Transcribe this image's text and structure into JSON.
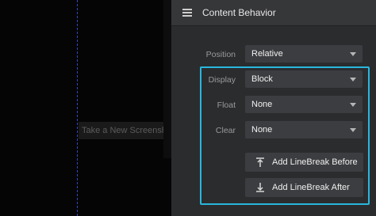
{
  "canvas": {
    "ghost_label": "Take a New Screenshot"
  },
  "panel": {
    "title": "Content Behavior",
    "menu_icon": "hamburger-icon",
    "rows": {
      "position": {
        "label": "Position",
        "value": "Relative"
      },
      "display": {
        "label": "Display",
        "value": "Block"
      },
      "float": {
        "label": "Float",
        "value": "None"
      },
      "clear": {
        "label": "Clear",
        "value": "None"
      }
    },
    "buttons": {
      "linebreak_before": {
        "label": "Add LineBreak Before",
        "icon": "linebreak-before-icon"
      },
      "linebreak_after": {
        "label": "Add LineBreak After",
        "icon": "linebreak-after-icon"
      }
    }
  },
  "colors": {
    "highlight": "#29b7de",
    "panel_bg": "#2b2c2e",
    "control_bg": "#3c3d40"
  }
}
